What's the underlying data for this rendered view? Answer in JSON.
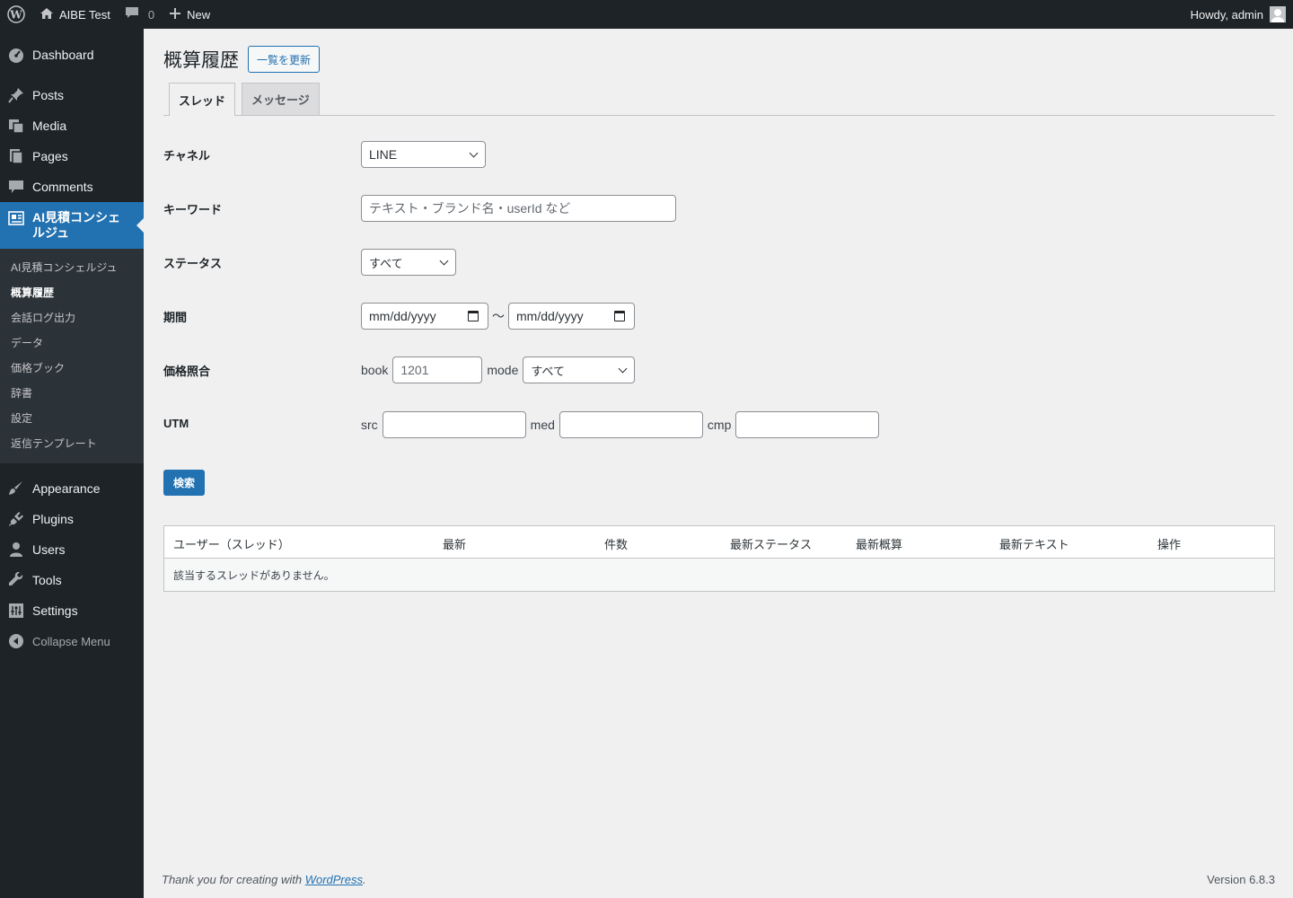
{
  "adminbar": {
    "site_name": "AIBE Test",
    "comments_count": "0",
    "new_label": "New",
    "howdy": "Howdy, admin"
  },
  "sidebar": {
    "items": [
      {
        "label": "Dashboard",
        "icon": "dashboard-icon"
      },
      {
        "label": "Posts",
        "icon": "pin-icon"
      },
      {
        "label": "Media",
        "icon": "media-icon"
      },
      {
        "label": "Pages",
        "icon": "pages-icon"
      },
      {
        "label": "Comments",
        "icon": "comment-icon"
      },
      {
        "label": "AI見積コンシェルジュ",
        "icon": "plugin-page-icon"
      },
      {
        "label": "Appearance",
        "icon": "brush-icon"
      },
      {
        "label": "Plugins",
        "icon": "plugin-icon"
      },
      {
        "label": "Users",
        "icon": "user-icon"
      },
      {
        "label": "Tools",
        "icon": "wrench-icon"
      },
      {
        "label": "Settings",
        "icon": "settings-icon"
      }
    ],
    "submenu": [
      "AI見積コンシェルジュ",
      "概算履歴",
      "会話ログ出力",
      "データ",
      "価格ブック",
      "辞書",
      "設定",
      "返信テンプレート"
    ],
    "collapse_label": "Collapse Menu"
  },
  "page": {
    "title": "概算履歴",
    "refresh_button": "一覧を更新",
    "tabs": [
      "スレッド",
      "メッセージ"
    ]
  },
  "form": {
    "channel": {
      "label": "チャネル",
      "value": "LINE"
    },
    "keyword": {
      "label": "キーワード",
      "placeholder": "テキスト・ブランド名・userId など"
    },
    "status": {
      "label": "ステータス",
      "value": "すべて"
    },
    "period": {
      "label": "期間",
      "from": "mm/dd/yyyy",
      "separator": "〜",
      "to": "mm/dd/yyyy"
    },
    "price": {
      "label": "価格照合",
      "book_label": "book",
      "book_value": "1201",
      "mode_label": "mode",
      "mode_value": "すべて"
    },
    "utm": {
      "label": "UTM",
      "src_label": "src",
      "med_label": "med",
      "cmp_label": "cmp"
    },
    "search_button": "検索"
  },
  "table": {
    "columns": [
      "ユーザー（スレッド）",
      "最新",
      "件数",
      "最新ステータス",
      "最新概算",
      "最新テキスト",
      "操作"
    ],
    "empty_message": "該当するスレッドがありません。"
  },
  "footer": {
    "thanks_prefix": "Thank you for creating with ",
    "thanks_link": "WordPress",
    "thanks_suffix": ".",
    "version": "Version 6.8.3"
  },
  "colors": {
    "accent": "#2271b1",
    "adminbar": "#1d2327",
    "background": "#f0f0f1"
  }
}
